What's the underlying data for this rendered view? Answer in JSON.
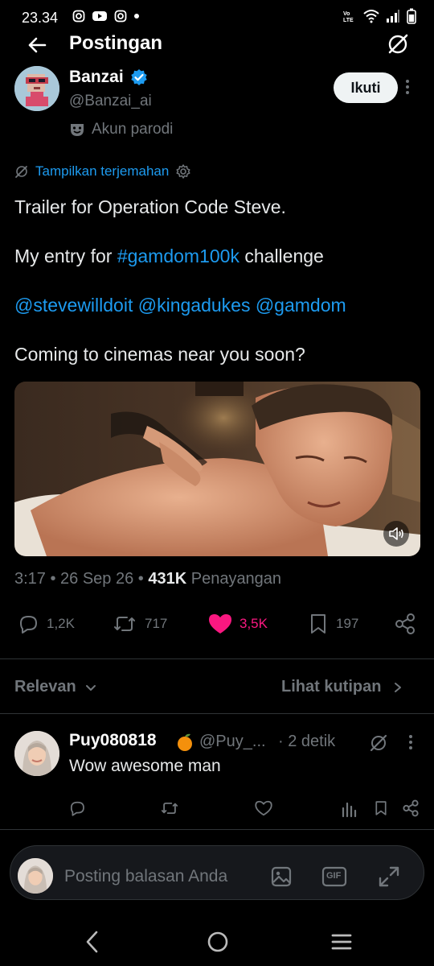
{
  "status_bar": {
    "time": "23.34"
  },
  "header": {
    "title": "Postingan"
  },
  "post": {
    "author_name": "Banzai",
    "author_handle": "@Banzai_ai",
    "follow_label": "Ikuti",
    "parody_label": "Akun parodi",
    "translate_label": "Tampilkan terjemahan",
    "line1": "Trailer for Operation Code Steve.",
    "line2_prefix": "My entry for ",
    "line2_hashtag": "#gamdom100k",
    "line2_suffix": " challenge",
    "mentions": "@stevewilldoit @kingadukes @gamdom",
    "line4": "Coming to cinemas near you soon?",
    "meta_time_date": "3:17 • 26 Sep 26 • ",
    "meta_views": "431K",
    "meta_views_label": " Penayangan",
    "replies": "1,2K",
    "reposts": "717",
    "likes": "3,5K",
    "bookmarks": "197",
    "like_color": "#f91880"
  },
  "sort": {
    "relevan_label": "Relevan",
    "quotes_label": "Lihat kutipan"
  },
  "reply": {
    "name": "Puy080818",
    "handle": "@Puy_...",
    "time": "· 2 detik",
    "text": "Wow awesome man"
  },
  "composer": {
    "placeholder": "Posting balasan Anda",
    "gif_label": "GIF"
  },
  "colors": {
    "accent": "#1d9bf0",
    "muted": "#71767b",
    "background": "#000000"
  }
}
